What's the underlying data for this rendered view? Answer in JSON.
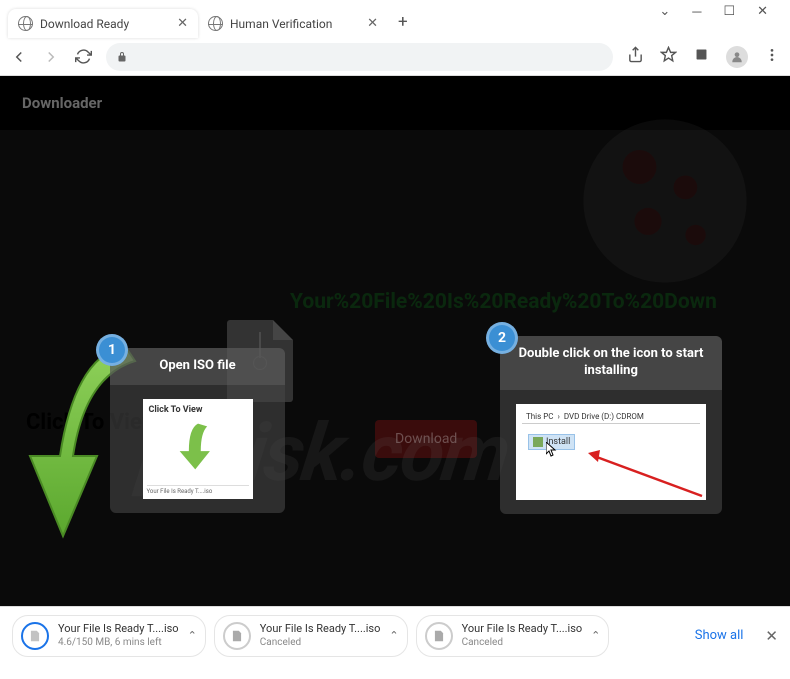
{
  "tabs": [
    {
      "title": "Download Ready"
    },
    {
      "title": "Human Verification"
    }
  ],
  "page": {
    "brand": "Downloader",
    "headline": "Your%20File%20Is%20Ready%20To%20Down",
    "click_text": "Click To View",
    "download_btn": "Download"
  },
  "steps": [
    {
      "num": "1",
      "title": "Open ISO file"
    },
    {
      "num": "2",
      "title": "Double click on the icon to start installing"
    }
  ],
  "screenshot1": {
    "caption": "Click To View",
    "footer": "Your File Is Ready T....iso"
  },
  "screenshot2": {
    "crumb1": "This PC",
    "crumb2": "DVD Drive (D:) CDROM",
    "item": "Install"
  },
  "downloads": [
    {
      "name": "Your File Is Ready T....iso",
      "status": "4.6/150 MB, 6 mins left"
    },
    {
      "name": "Your File Is Ready T....iso",
      "status": "Canceled"
    },
    {
      "name": "Your File Is Ready T....iso",
      "status": "Canceled"
    }
  ],
  "shelf": {
    "showall": "Show all"
  },
  "watermark_text": "pcrisk.com"
}
